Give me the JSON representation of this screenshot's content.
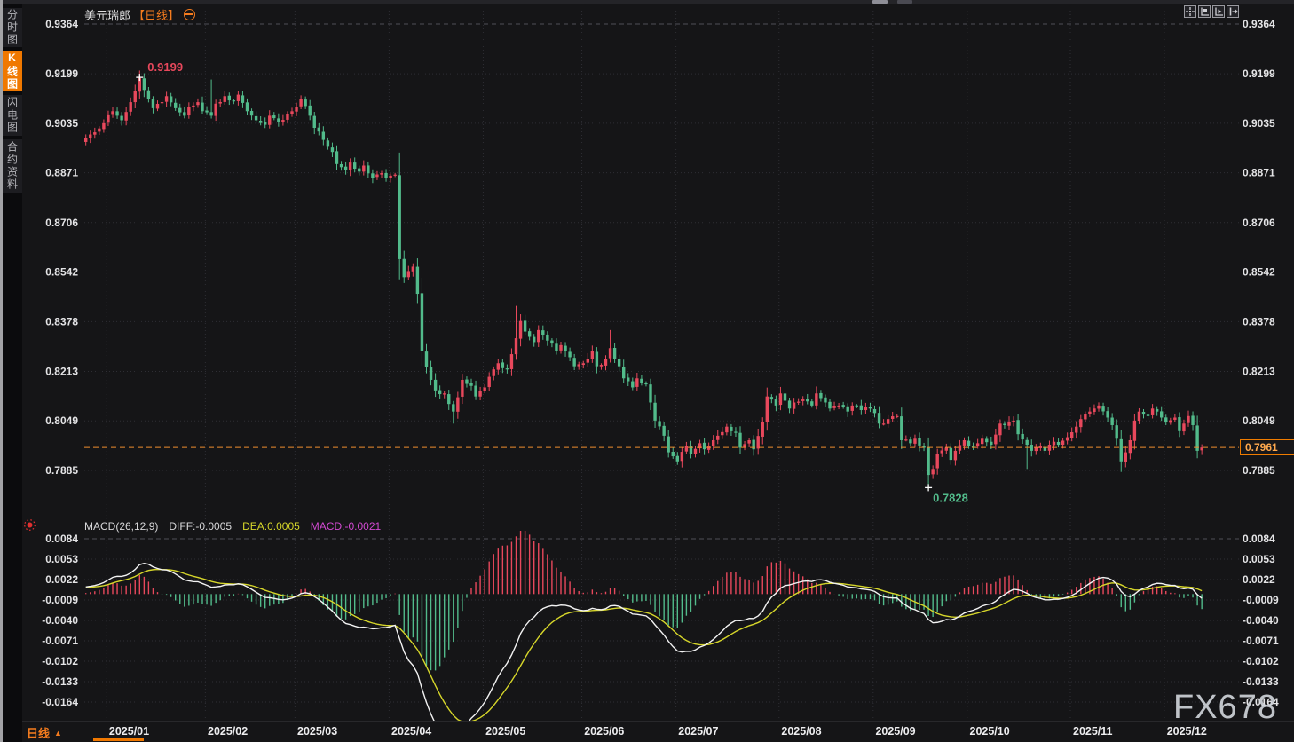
{
  "sidebar": {
    "tabs": [
      {
        "label": "分时图",
        "active": false
      },
      {
        "label": "K线图",
        "active": true
      },
      {
        "label": "闪电图",
        "active": false
      },
      {
        "label": "合约资料",
        "active": false
      }
    ]
  },
  "header": {
    "symbol": "美元瑞郎",
    "period_tag": "【日线】",
    "settings_icon": "circle-minus-icon"
  },
  "toolbar": {
    "buttons": [
      {
        "icon": "crosshair-move-icon"
      },
      {
        "icon": "axis-flag-icon"
      },
      {
        "icon": "axis-play-icon"
      },
      {
        "icon": "collapse-right-icon"
      }
    ]
  },
  "macd_header": {
    "title": "MACD(26,12,9)",
    "diff": "DIFF:-0.0005",
    "dea": "DEA:0.0005",
    "macd": "MACD:-0.0021",
    "alert_icon": "red-dot-icon"
  },
  "annotations": {
    "high": {
      "label": "0.9199",
      "index": 12,
      "price": 0.9199
    },
    "low": {
      "label": "0.7828",
      "index": 188,
      "price": 0.7828
    },
    "last": {
      "label": "0.7961",
      "price": 0.7961
    }
  },
  "bottom": {
    "period_label": "日线",
    "arrow": "▲"
  },
  "watermark": "FX678",
  "colors": {
    "up": "#e8485c",
    "down": "#52bb8b",
    "accent": "#f57c1e",
    "diff_line": "#f2f2f2",
    "dea_line": "#d6d62a",
    "macd_value": "#d24ad2",
    "grid": "#2e2e34",
    "grid_bright": "#4f4f57",
    "axis_text": "#e4e4e6",
    "price_line": "#ef8d2e",
    "date_text": "#eeeef0"
  },
  "chart_data": {
    "type": "candlestick",
    "title": "美元瑞郎 日线 (USD/CHF daily) with MACD(26,12,9)",
    "candle_count": 250,
    "price_axis_ticks": [
      0.9364,
      0.9199,
      0.9035,
      0.8871,
      0.8706,
      0.8542,
      0.8378,
      0.8213,
      0.8049,
      0.7885
    ],
    "macd_axis_ticks": [
      0.0084,
      0.0053,
      0.0022,
      -0.0009,
      -0.004,
      -0.0071,
      -0.0102,
      -0.0133,
      -0.0164
    ],
    "months": [
      {
        "label": "2025/01",
        "index": 10
      },
      {
        "label": "2025/02",
        "index": 32
      },
      {
        "label": "2025/03",
        "index": 52
      },
      {
        "label": "2025/04",
        "index": 73
      },
      {
        "label": "2025/05",
        "index": 94
      },
      {
        "label": "2025/06",
        "index": 116
      },
      {
        "label": "2025/07",
        "index": 137
      },
      {
        "label": "2025/08",
        "index": 160
      },
      {
        "label": "2025/09",
        "index": 181
      },
      {
        "label": "2025/10",
        "index": 202
      },
      {
        "label": "2025/11",
        "index": 225
      },
      {
        "label": "2025/12",
        "index": 246
      }
    ],
    "key_points": {
      "high": 0.9199,
      "low": 0.7828,
      "last": 0.7961
    },
    "indicator": {
      "name": "MACD",
      "params": [
        26,
        12,
        9
      ],
      "diff": -0.0005,
      "dea": 0.0005,
      "macd": -0.0021
    },
    "close_waypoints": [
      [
        0,
        0.8985
      ],
      [
        2,
        0.9005
      ],
      [
        4,
        0.9035
      ],
      [
        6,
        0.9075
      ],
      [
        8,
        0.9045
      ],
      [
        10,
        0.9105
      ],
      [
        12,
        0.9185
      ],
      [
        14,
        0.9115
      ],
      [
        15,
        0.9085
      ],
      [
        17,
        0.9105
      ],
      [
        18,
        0.9125
      ],
      [
        20,
        0.9085
      ],
      [
        22,
        0.906
      ],
      [
        23,
        0.909
      ],
      [
        25,
        0.9105
      ],
      [
        26,
        0.9075
      ],
      [
        28,
        0.906
      ],
      [
        29,
        0.91
      ],
      [
        31,
        0.9125
      ],
      [
        33,
        0.911
      ],
      [
        34,
        0.913
      ],
      [
        36,
        0.9075
      ],
      [
        38,
        0.9045
      ],
      [
        40,
        0.903
      ],
      [
        41,
        0.906
      ],
      [
        43,
        0.904
      ],
      [
        45,
        0.9065
      ],
      [
        47,
        0.909
      ],
      [
        48,
        0.9115
      ],
      [
        50,
        0.906
      ],
      [
        51,
        0.902
      ],
      [
        53,
        0.898
      ],
      [
        55,
        0.894
      ],
      [
        56,
        0.89
      ],
      [
        58,
        0.888
      ],
      [
        59,
        0.8905
      ],
      [
        61,
        0.8875
      ],
      [
        62,
        0.8895
      ],
      [
        64,
        0.8855
      ],
      [
        66,
        0.887
      ],
      [
        67,
        0.8855
      ],
      [
        69,
        0.8865
      ],
      [
        70,
        0.8585
      ],
      [
        71,
        0.8525
      ],
      [
        73,
        0.856
      ],
      [
        74,
        0.847
      ],
      [
        75,
        0.828
      ],
      [
        77,
        0.8185
      ],
      [
        78,
        0.815
      ],
      [
        80,
        0.814
      ],
      [
        81,
        0.8105
      ],
      [
        82,
        0.808
      ],
      [
        84,
        0.8185
      ],
      [
        86,
        0.8165
      ],
      [
        87,
        0.813
      ],
      [
        89,
        0.816
      ],
      [
        90,
        0.8195
      ],
      [
        92,
        0.824
      ],
      [
        94,
        0.822
      ],
      [
        95,
        0.827
      ],
      [
        97,
        0.838
      ],
      [
        98,
        0.8345
      ],
      [
        100,
        0.831
      ],
      [
        101,
        0.835
      ],
      [
        103,
        0.8315
      ],
      [
        105,
        0.828
      ],
      [
        106,
        0.83
      ],
      [
        108,
        0.826
      ],
      [
        109,
        0.823
      ],
      [
        111,
        0.824
      ],
      [
        113,
        0.828
      ],
      [
        114,
        0.823
      ],
      [
        116,
        0.8255
      ],
      [
        117,
        0.829
      ],
      [
        119,
        0.823
      ],
      [
        120,
        0.819
      ],
      [
        122,
        0.816
      ],
      [
        123,
        0.819
      ],
      [
        125,
        0.817
      ],
      [
        126,
        0.811
      ],
      [
        127,
        0.805
      ],
      [
        129,
        0.8
      ],
      [
        130,
        0.7945
      ],
      [
        132,
        0.7915
      ],
      [
        134,
        0.7965
      ],
      [
        135,
        0.794
      ],
      [
        137,
        0.7975
      ],
      [
        138,
        0.7955
      ],
      [
        140,
        0.7985
      ],
      [
        141,
        0.8
      ],
      [
        143,
        0.803
      ],
      [
        145,
        0.801
      ],
      [
        146,
        0.796
      ],
      [
        148,
        0.7985
      ],
      [
        149,
        0.7955
      ],
      [
        151,
        0.8045
      ],
      [
        152,
        0.813
      ],
      [
        154,
        0.81
      ],
      [
        155,
        0.814
      ],
      [
        157,
        0.809
      ],
      [
        158,
        0.811
      ],
      [
        160,
        0.812
      ],
      [
        162,
        0.81
      ],
      [
        163,
        0.814
      ],
      [
        165,
        0.811
      ],
      [
        166,
        0.809
      ],
      [
        168,
        0.81
      ],
      [
        170,
        0.808
      ],
      [
        171,
        0.81
      ],
      [
        173,
        0.8085
      ],
      [
        174,
        0.8095
      ],
      [
        176,
        0.8075
      ],
      [
        177,
        0.804
      ],
      [
        179,
        0.8055
      ],
      [
        181,
        0.8065
      ],
      [
        182,
        0.7985
      ],
      [
        184,
        0.7975
      ],
      [
        185,
        0.799
      ],
      [
        187,
        0.796
      ],
      [
        188,
        0.787
      ],
      [
        189,
        0.789
      ],
      [
        190,
        0.794
      ],
      [
        192,
        0.796
      ],
      [
        193,
        0.792
      ],
      [
        194,
        0.795
      ],
      [
        196,
        0.7985
      ],
      [
        197,
        0.7965
      ],
      [
        199,
        0.7975
      ],
      [
        200,
        0.799
      ],
      [
        202,
        0.797
      ],
      [
        204,
        0.804
      ],
      [
        205,
        0.8035
      ],
      [
        207,
        0.805
      ],
      [
        208,
        0.8005
      ],
      [
        210,
        0.797
      ],
      [
        211,
        0.795
      ],
      [
        213,
        0.7965
      ],
      [
        214,
        0.795
      ],
      [
        216,
        0.798
      ],
      [
        217,
        0.797
      ],
      [
        219,
        0.7995
      ],
      [
        221,
        0.803
      ],
      [
        222,
        0.8055
      ],
      [
        224,
        0.808
      ],
      [
        225,
        0.809
      ],
      [
        226,
        0.81
      ],
      [
        228,
        0.806
      ],
      [
        229,
        0.8035
      ],
      [
        230,
        0.799
      ],
      [
        231,
        0.7915
      ],
      [
        232,
        0.7945
      ],
      [
        233,
        0.7985
      ],
      [
        234,
        0.805
      ],
      [
        235,
        0.808
      ],
      [
        237,
        0.8065
      ],
      [
        238,
        0.809
      ],
      [
        240,
        0.806
      ],
      [
        241,
        0.8045
      ],
      [
        243,
        0.806
      ],
      [
        244,
        0.8015
      ],
      [
        245,
        0.804
      ],
      [
        246,
        0.8065
      ],
      [
        247,
        0.8035
      ],
      [
        248,
        0.795
      ],
      [
        249,
        0.7961
      ]
    ],
    "wick_extremes": [
      {
        "i": 12,
        "high": 0.9199
      },
      {
        "i": 28,
        "high": 0.918
      },
      {
        "i": 96,
        "high": 0.843
      },
      {
        "i": 117,
        "high": 0.835
      },
      {
        "i": 82,
        "low": 0.804
      },
      {
        "i": 188,
        "low": 0.7828
      },
      {
        "i": 210,
        "low": 0.789
      },
      {
        "i": 231,
        "low": 0.788
      }
    ]
  }
}
